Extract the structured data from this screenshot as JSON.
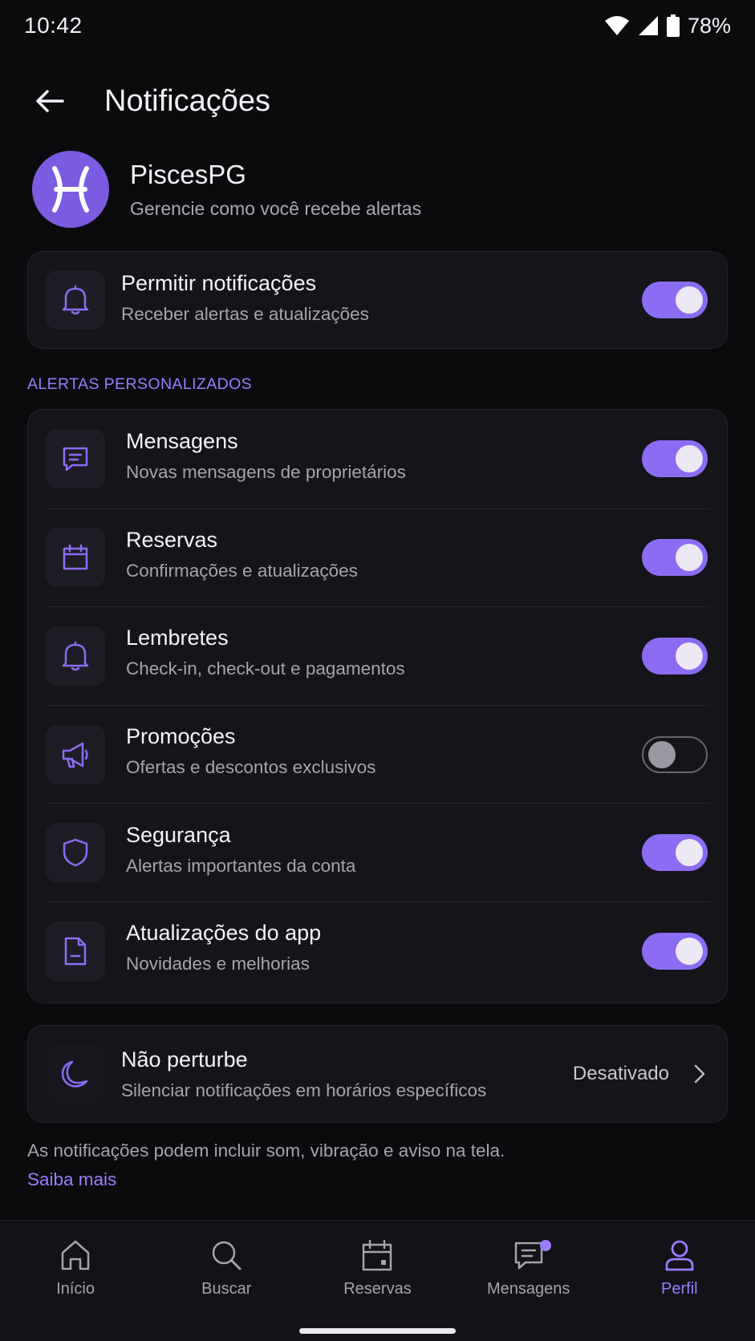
{
  "status_bar": {
    "time": "10:42",
    "battery_percent": "78%",
    "icons": [
      "wifi-icon",
      "cellular-signal-icon",
      "battery-icon"
    ]
  },
  "header": {
    "title": "Notificações",
    "back_icon": "arrow-left-icon"
  },
  "profile": {
    "name": "PiscesPG",
    "subtitle": "Gerencie como você recebe alertas",
    "avatar_icon": "pisces-symbol-icon",
    "avatar_color": "#7b5be0"
  },
  "allow_notifications": {
    "title": "Permitir notificações",
    "subtitle": "Receber alertas e atualizações",
    "icon": "bell-icon",
    "enabled": true
  },
  "section_label": "ALERTAS PERSONALIZADOS",
  "alerts": [
    {
      "title": "Mensagens",
      "subtitle": "Novas mensagens de proprietários",
      "icon": "message-icon",
      "enabled": true
    },
    {
      "title": "Reservas",
      "subtitle": "Confirmações e atualizações",
      "icon": "calendar-icon",
      "enabled": true
    },
    {
      "title": "Lembretes",
      "subtitle": "Check-in, check-out e pagamentos",
      "icon": "bell-icon",
      "enabled": true
    },
    {
      "title": "Promoções",
      "subtitle": "Ofertas e descontos exclusivos",
      "icon": "megaphone-icon",
      "enabled": false
    },
    {
      "title": "Segurança",
      "subtitle": "Alertas importantes da conta",
      "icon": "shield-icon",
      "enabled": true
    },
    {
      "title": "Atualizações do app",
      "subtitle": "Novidades e melhorias",
      "icon": "document-icon",
      "enabled": true
    }
  ],
  "do_not_disturb": {
    "title": "Não perturbe",
    "subtitle": "Silenciar notificações em horários específicos",
    "value": "Desativado",
    "icon": "moon-icon"
  },
  "footer": {
    "note": "As notificações podem incluir som, vibração e aviso na tela.",
    "link": "Saiba mais"
  },
  "bottom_nav": {
    "items": [
      {
        "label": "Início",
        "icon": "home-icon",
        "active": false
      },
      {
        "label": "Buscar",
        "icon": "search-icon",
        "active": false
      },
      {
        "label": "Reservas",
        "icon": "calendar-icon",
        "active": false
      },
      {
        "label": "Mensagens",
        "icon": "message-icon",
        "active": false,
        "badge": true
      },
      {
        "label": "Perfil",
        "icon": "profile-icon",
        "active": true
      }
    ]
  },
  "colors": {
    "accent": "#8b6cf2",
    "accent_text": "#9b7dff",
    "background": "#0b0b0e",
    "card": "#141419"
  }
}
